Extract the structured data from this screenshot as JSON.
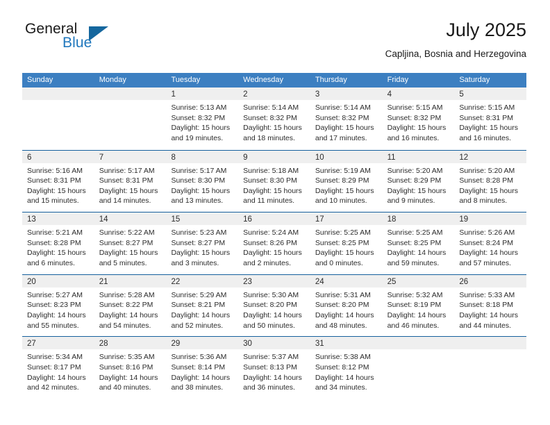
{
  "brand": {
    "name_part1": "General",
    "name_part2": "Blue",
    "triangle_icon": "triangle-logo-icon",
    "accent_color": "#15679e",
    "blue_text_color": "#1f77bd"
  },
  "header": {
    "month_title": "July 2025",
    "location": "Capljina, Bosnia and Herzegovina"
  },
  "calendar": {
    "header_bg": "#3c7fc1",
    "row_divider_color": "#15609d",
    "day_strip_bg": "#efefef",
    "weekdays": [
      "Sunday",
      "Monday",
      "Tuesday",
      "Wednesday",
      "Thursday",
      "Friday",
      "Saturday"
    ],
    "weeks": [
      [
        {
          "day": "",
          "empty": true
        },
        {
          "day": "",
          "empty": true
        },
        {
          "day": "1",
          "sunrise": "Sunrise: 5:13 AM",
          "sunset": "Sunset: 8:32 PM",
          "daylight1": "Daylight: 15 hours",
          "daylight2": "and 19 minutes."
        },
        {
          "day": "2",
          "sunrise": "Sunrise: 5:14 AM",
          "sunset": "Sunset: 8:32 PM",
          "daylight1": "Daylight: 15 hours",
          "daylight2": "and 18 minutes."
        },
        {
          "day": "3",
          "sunrise": "Sunrise: 5:14 AM",
          "sunset": "Sunset: 8:32 PM",
          "daylight1": "Daylight: 15 hours",
          "daylight2": "and 17 minutes."
        },
        {
          "day": "4",
          "sunrise": "Sunrise: 5:15 AM",
          "sunset": "Sunset: 8:32 PM",
          "daylight1": "Daylight: 15 hours",
          "daylight2": "and 16 minutes."
        },
        {
          "day": "5",
          "sunrise": "Sunrise: 5:15 AM",
          "sunset": "Sunset: 8:31 PM",
          "daylight1": "Daylight: 15 hours",
          "daylight2": "and 16 minutes."
        }
      ],
      [
        {
          "day": "6",
          "sunrise": "Sunrise: 5:16 AM",
          "sunset": "Sunset: 8:31 PM",
          "daylight1": "Daylight: 15 hours",
          "daylight2": "and 15 minutes."
        },
        {
          "day": "7",
          "sunrise": "Sunrise: 5:17 AM",
          "sunset": "Sunset: 8:31 PM",
          "daylight1": "Daylight: 15 hours",
          "daylight2": "and 14 minutes."
        },
        {
          "day": "8",
          "sunrise": "Sunrise: 5:17 AM",
          "sunset": "Sunset: 8:30 PM",
          "daylight1": "Daylight: 15 hours",
          "daylight2": "and 13 minutes."
        },
        {
          "day": "9",
          "sunrise": "Sunrise: 5:18 AM",
          "sunset": "Sunset: 8:30 PM",
          "daylight1": "Daylight: 15 hours",
          "daylight2": "and 11 minutes."
        },
        {
          "day": "10",
          "sunrise": "Sunrise: 5:19 AM",
          "sunset": "Sunset: 8:29 PM",
          "daylight1": "Daylight: 15 hours",
          "daylight2": "and 10 minutes."
        },
        {
          "day": "11",
          "sunrise": "Sunrise: 5:20 AM",
          "sunset": "Sunset: 8:29 PM",
          "daylight1": "Daylight: 15 hours",
          "daylight2": "and 9 minutes."
        },
        {
          "day": "12",
          "sunrise": "Sunrise: 5:20 AM",
          "sunset": "Sunset: 8:28 PM",
          "daylight1": "Daylight: 15 hours",
          "daylight2": "and 8 minutes."
        }
      ],
      [
        {
          "day": "13",
          "sunrise": "Sunrise: 5:21 AM",
          "sunset": "Sunset: 8:28 PM",
          "daylight1": "Daylight: 15 hours",
          "daylight2": "and 6 minutes."
        },
        {
          "day": "14",
          "sunrise": "Sunrise: 5:22 AM",
          "sunset": "Sunset: 8:27 PM",
          "daylight1": "Daylight: 15 hours",
          "daylight2": "and 5 minutes."
        },
        {
          "day": "15",
          "sunrise": "Sunrise: 5:23 AM",
          "sunset": "Sunset: 8:27 PM",
          "daylight1": "Daylight: 15 hours",
          "daylight2": "and 3 minutes."
        },
        {
          "day": "16",
          "sunrise": "Sunrise: 5:24 AM",
          "sunset": "Sunset: 8:26 PM",
          "daylight1": "Daylight: 15 hours",
          "daylight2": "and 2 minutes."
        },
        {
          "day": "17",
          "sunrise": "Sunrise: 5:25 AM",
          "sunset": "Sunset: 8:25 PM",
          "daylight1": "Daylight: 15 hours",
          "daylight2": "and 0 minutes."
        },
        {
          "day": "18",
          "sunrise": "Sunrise: 5:25 AM",
          "sunset": "Sunset: 8:25 PM",
          "daylight1": "Daylight: 14 hours",
          "daylight2": "and 59 minutes."
        },
        {
          "day": "19",
          "sunrise": "Sunrise: 5:26 AM",
          "sunset": "Sunset: 8:24 PM",
          "daylight1": "Daylight: 14 hours",
          "daylight2": "and 57 minutes."
        }
      ],
      [
        {
          "day": "20",
          "sunrise": "Sunrise: 5:27 AM",
          "sunset": "Sunset: 8:23 PM",
          "daylight1": "Daylight: 14 hours",
          "daylight2": "and 55 minutes."
        },
        {
          "day": "21",
          "sunrise": "Sunrise: 5:28 AM",
          "sunset": "Sunset: 8:22 PM",
          "daylight1": "Daylight: 14 hours",
          "daylight2": "and 54 minutes."
        },
        {
          "day": "22",
          "sunrise": "Sunrise: 5:29 AM",
          "sunset": "Sunset: 8:21 PM",
          "daylight1": "Daylight: 14 hours",
          "daylight2": "and 52 minutes."
        },
        {
          "day": "23",
          "sunrise": "Sunrise: 5:30 AM",
          "sunset": "Sunset: 8:20 PM",
          "daylight1": "Daylight: 14 hours",
          "daylight2": "and 50 minutes."
        },
        {
          "day": "24",
          "sunrise": "Sunrise: 5:31 AM",
          "sunset": "Sunset: 8:20 PM",
          "daylight1": "Daylight: 14 hours",
          "daylight2": "and 48 minutes."
        },
        {
          "day": "25",
          "sunrise": "Sunrise: 5:32 AM",
          "sunset": "Sunset: 8:19 PM",
          "daylight1": "Daylight: 14 hours",
          "daylight2": "and 46 minutes."
        },
        {
          "day": "26",
          "sunrise": "Sunrise: 5:33 AM",
          "sunset": "Sunset: 8:18 PM",
          "daylight1": "Daylight: 14 hours",
          "daylight2": "and 44 minutes."
        }
      ],
      [
        {
          "day": "27",
          "sunrise": "Sunrise: 5:34 AM",
          "sunset": "Sunset: 8:17 PM",
          "daylight1": "Daylight: 14 hours",
          "daylight2": "and 42 minutes."
        },
        {
          "day": "28",
          "sunrise": "Sunrise: 5:35 AM",
          "sunset": "Sunset: 8:16 PM",
          "daylight1": "Daylight: 14 hours",
          "daylight2": "and 40 minutes."
        },
        {
          "day": "29",
          "sunrise": "Sunrise: 5:36 AM",
          "sunset": "Sunset: 8:14 PM",
          "daylight1": "Daylight: 14 hours",
          "daylight2": "and 38 minutes."
        },
        {
          "day": "30",
          "sunrise": "Sunrise: 5:37 AM",
          "sunset": "Sunset: 8:13 PM",
          "daylight1": "Daylight: 14 hours",
          "daylight2": "and 36 minutes."
        },
        {
          "day": "31",
          "sunrise": "Sunrise: 5:38 AM",
          "sunset": "Sunset: 8:12 PM",
          "daylight1": "Daylight: 14 hours",
          "daylight2": "and 34 minutes."
        },
        {
          "day": "",
          "empty": true
        },
        {
          "day": "",
          "empty": true
        }
      ]
    ]
  }
}
